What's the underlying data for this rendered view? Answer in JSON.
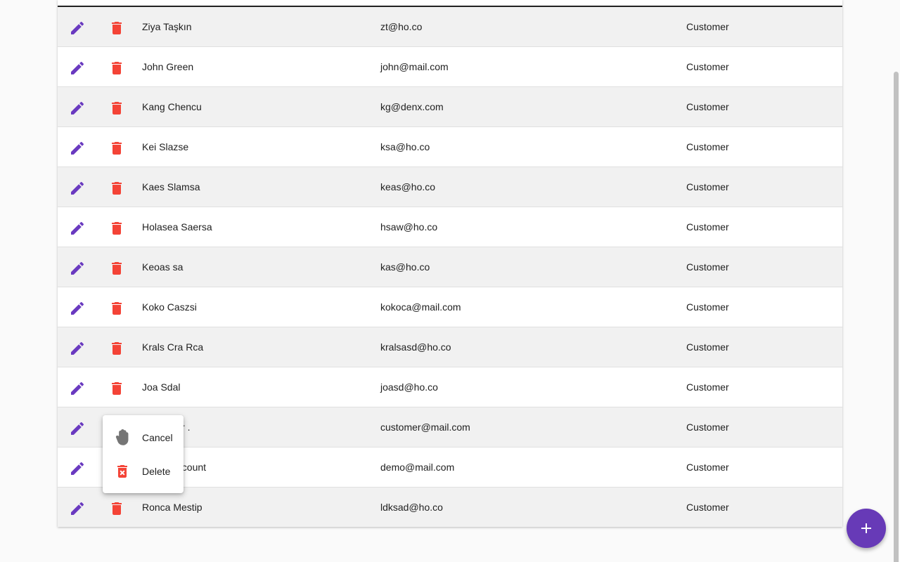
{
  "colors": {
    "accent": "#673ab7",
    "edit_icon": "#6a3ac0",
    "delete_icon": "#f44336",
    "row_odd": "#f1f1f1",
    "row_even": "#ffffff"
  },
  "table": {
    "rows": [
      {
        "name": "Ziya Taşkın",
        "email": "zt@ho.co",
        "role": "Customer"
      },
      {
        "name": "John Green",
        "email": "john@mail.com",
        "role": "Customer"
      },
      {
        "name": "Kang Chencu",
        "email": "kg@denx.com",
        "role": "Customer"
      },
      {
        "name": "Kei Slazse",
        "email": "ksa@ho.co",
        "role": "Customer"
      },
      {
        "name": "Kaes Slamsa",
        "email": "keas@ho.co",
        "role": "Customer"
      },
      {
        "name": "Holasea Saersa",
        "email": "hsaw@ho.co",
        "role": "Customer"
      },
      {
        "name": "Keoas sa",
        "email": "kas@ho.co",
        "role": "Customer"
      },
      {
        "name": "Koko Caszsi",
        "email": "kokoca@mail.com",
        "role": "Customer"
      },
      {
        "name": "Krals Cra Rca",
        "email": "kralsasd@ho.co",
        "role": "Customer"
      },
      {
        "name": "Joa Sdal",
        "email": "joasd@ho.co",
        "role": "Customer"
      },
      {
        "name": "Customer .",
        "email": "customer@mail.com",
        "role": "Customer"
      },
      {
        "name": "Demo Account",
        "email": "demo@mail.com",
        "role": "Customer"
      },
      {
        "name": "Ronca Mestip",
        "email": "ldksad@ho.co",
        "role": "Customer"
      }
    ],
    "row_actions": {
      "edit_icon": "pencil-icon",
      "delete_icon": "trash-icon"
    }
  },
  "confirm_popup": {
    "cancel_label": "Cancel",
    "cancel_icon": "hand-stop-icon",
    "delete_label": "Delete",
    "delete_icon": "trash-x-icon"
  },
  "fab": {
    "icon": "plus-icon",
    "label": "Add"
  }
}
